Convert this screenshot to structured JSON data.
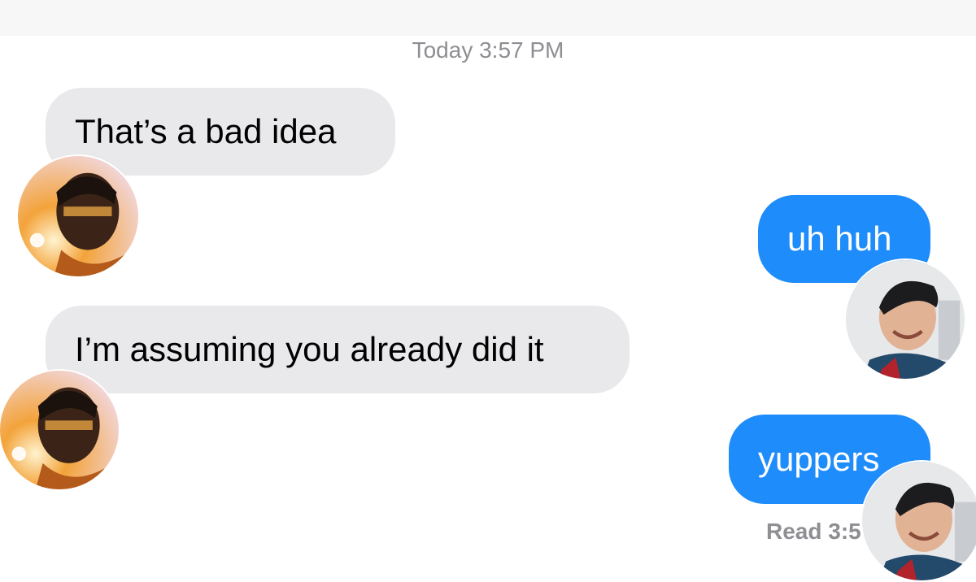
{
  "conversation": {
    "timestamp": "Today 3:57 PM",
    "messages": [
      {
        "direction": "incoming",
        "text": "That’s a bad idea",
        "avatar_icon": "hero-avatar-icon-a"
      },
      {
        "direction": "outgoing",
        "text": "uh huh",
        "avatar_icon": "hero-avatar-icon-b"
      },
      {
        "direction": "incoming",
        "text": "I’m assuming you already did it",
        "avatar_icon": "hero-avatar-icon-a"
      },
      {
        "direction": "outgoing",
        "text": "yuppers",
        "avatar_icon": "hero-avatar-icon-b"
      }
    ],
    "read_receipt": "Read 3:5"
  },
  "colors": {
    "incoming_bubble": "#e9e9eb",
    "outgoing_bubble": "#1e8cfa",
    "meta_text": "#8e8e93"
  }
}
